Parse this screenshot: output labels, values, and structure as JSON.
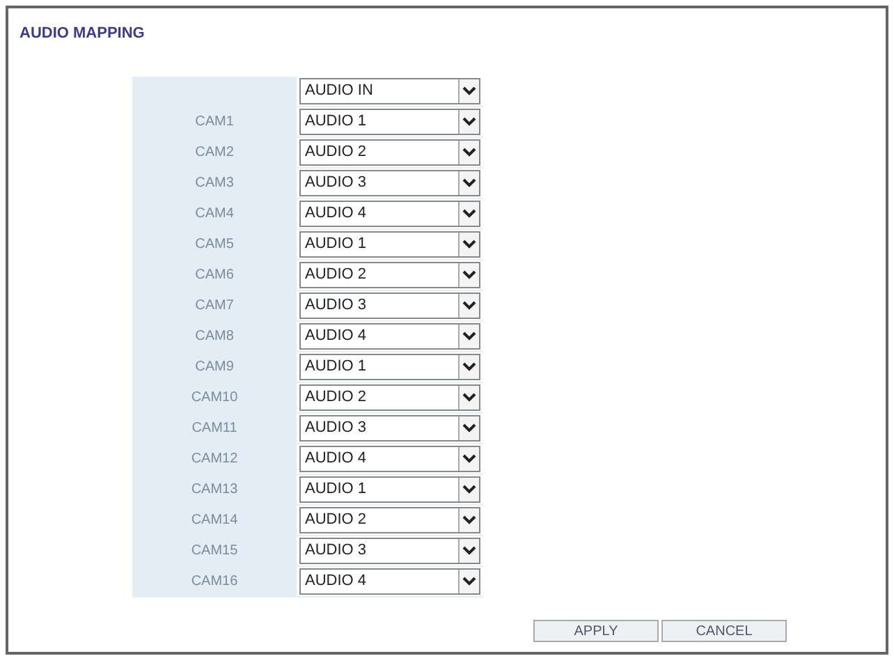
{
  "title": "AUDIO MAPPING",
  "header": {
    "value": "AUDIO IN"
  },
  "rows": [
    {
      "camera": "CAM1",
      "audio": "AUDIO 1"
    },
    {
      "camera": "CAM2",
      "audio": "AUDIO 2"
    },
    {
      "camera": "CAM3",
      "audio": "AUDIO 3"
    },
    {
      "camera": "CAM4",
      "audio": "AUDIO 4"
    },
    {
      "camera": "CAM5",
      "audio": "AUDIO 1"
    },
    {
      "camera": "CAM6",
      "audio": "AUDIO 2"
    },
    {
      "camera": "CAM7",
      "audio": "AUDIO 3"
    },
    {
      "camera": "CAM8",
      "audio": "AUDIO 4"
    },
    {
      "camera": "CAM9",
      "audio": "AUDIO 1"
    },
    {
      "camera": "CAM10",
      "audio": "AUDIO 2"
    },
    {
      "camera": "CAM11",
      "audio": "AUDIO 3"
    },
    {
      "camera": "CAM12",
      "audio": "AUDIO 4"
    },
    {
      "camera": "CAM13",
      "audio": "AUDIO 1"
    },
    {
      "camera": "CAM14",
      "audio": "AUDIO 2"
    },
    {
      "camera": "CAM15",
      "audio": "AUDIO 3"
    },
    {
      "camera": "CAM16",
      "audio": "AUDIO 4"
    }
  ],
  "buttons": [
    "APPLY",
    "CANCEL"
  ]
}
